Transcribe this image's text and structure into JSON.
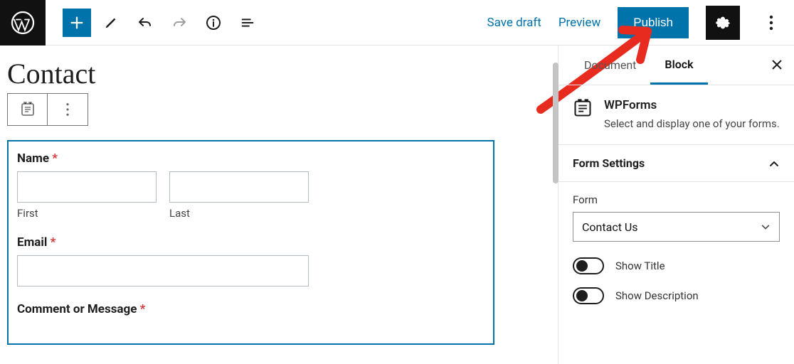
{
  "topbar": {
    "save_draft": "Save draft",
    "preview": "Preview",
    "publish": "Publish"
  },
  "editor": {
    "page_title": "Contact",
    "form": {
      "name_label": "Name",
      "first_sublabel": "First",
      "last_sublabel": "Last",
      "email_label": "Email",
      "comment_label": "Comment or Message"
    }
  },
  "sidebar": {
    "tabs": {
      "document": "Document",
      "block": "Block"
    },
    "block_panel": {
      "title": "WPForms",
      "description": "Select and display one of your forms."
    },
    "form_settings": {
      "heading": "Form Settings",
      "form_label": "Form",
      "form_selected": "Contact Us",
      "show_title": "Show Title",
      "show_description": "Show Description"
    }
  },
  "annotation": {
    "arrow_color": "#e82b1f"
  }
}
